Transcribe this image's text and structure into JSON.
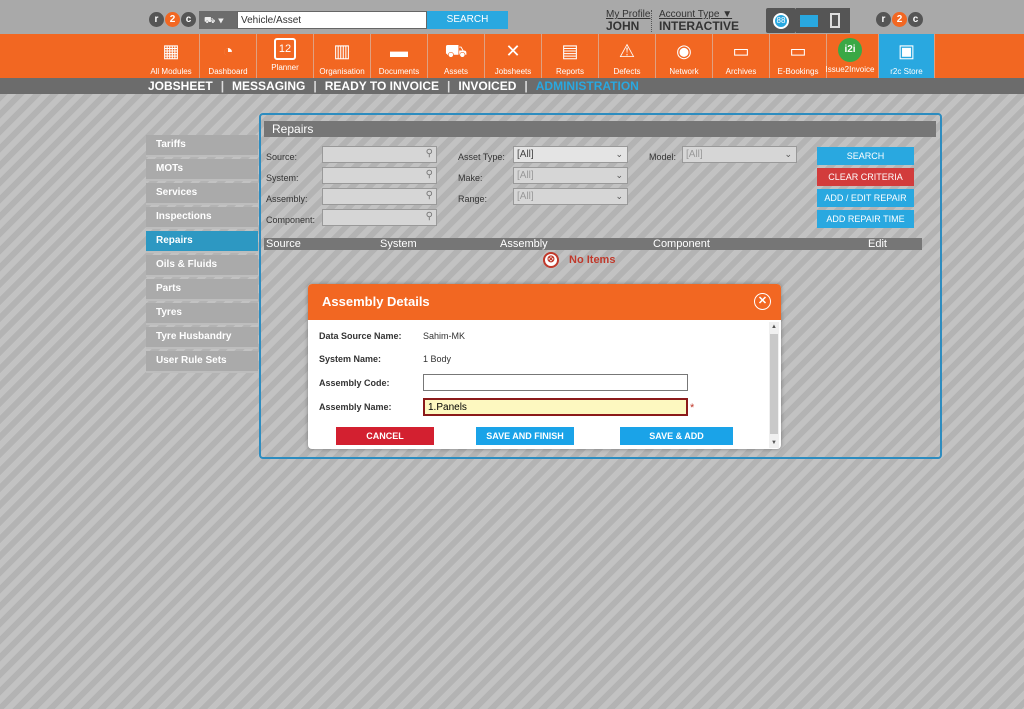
{
  "header": {
    "logo_left": [
      "r",
      "2",
      "c"
    ],
    "logo_right": [
      "r",
      "2",
      "c"
    ],
    "search_placeholder": "Vehicle/Asset",
    "search_button": "SEARCH",
    "my_profile": "My Profile",
    "user_name": "JOHN",
    "account_type": "Account Type",
    "account_name": "INTERACTIVE",
    "notif_count": "88"
  },
  "nav": {
    "modules": [
      {
        "label": "All Modules",
        "icon": "grid-icon",
        "glyph": "▦"
      },
      {
        "label": "Dashboard",
        "icon": "speedometer-icon",
        "glyph": "◔"
      },
      {
        "label": "Planner",
        "icon": "calendar-icon",
        "glyph": "12"
      },
      {
        "label": "Organisation",
        "icon": "buildings-icon",
        "glyph": "▥"
      },
      {
        "label": "Documents",
        "icon": "folder-icon",
        "glyph": "▬"
      },
      {
        "label": "Assets",
        "icon": "truck-icon",
        "glyph": "⛟"
      },
      {
        "label": "Jobsheets",
        "icon": "tools-icon",
        "glyph": "✕"
      },
      {
        "label": "Reports",
        "icon": "clipboard-icon",
        "glyph": "▤"
      },
      {
        "label": "Defects",
        "icon": "warning-icon",
        "glyph": "⚠"
      },
      {
        "label": "Network",
        "icon": "contacts-icon",
        "glyph": "◉"
      },
      {
        "label": "Archives",
        "icon": "archive-icon",
        "glyph": "▭"
      },
      {
        "label": "E-Bookings",
        "icon": "laptop-icon",
        "glyph": "▭"
      },
      {
        "label": "Issue2Invoice",
        "icon": "i2i-icon",
        "glyph": "i2i"
      },
      {
        "label": "r2c Store",
        "icon": "briefcase-icon",
        "glyph": "▣"
      }
    ]
  },
  "subnav": {
    "items": [
      "JOBSHEET",
      "MESSAGING",
      "READY TO INVOICE",
      "INVOICED",
      "ADMINISTRATION"
    ],
    "sep": "|"
  },
  "sidebar": {
    "items": [
      "Tariffs",
      "MOTs",
      "Services",
      "Inspections",
      "Repairs",
      "Oils & Fluids",
      "Parts",
      "Tyres",
      "Tyre Husbandry",
      "User Rule Sets"
    ]
  },
  "repairs": {
    "title": "Repairs",
    "labels": {
      "source": "Source:",
      "system": "System:",
      "assembly": "Assembly:",
      "component": "Component:",
      "asset_type": "Asset Type:",
      "make": "Make:",
      "range": "Range:",
      "model": "Model:"
    },
    "selects": {
      "asset_type": "[All]",
      "make": "[All]",
      "range": "[All]",
      "model": "[All]"
    },
    "buttons": {
      "search": "SEARCH",
      "clear": "CLEAR CRITERIA",
      "add_edit": "ADD / EDIT REPAIR",
      "add_time": "ADD REPAIR TIME"
    },
    "table_headers": [
      "Source",
      "System",
      "Assembly",
      "Component",
      "Edit"
    ],
    "no_items": "No Items",
    "no_items_icon": "⊗"
  },
  "modal": {
    "title": "Assembly Details",
    "close": "✕",
    "fields": {
      "data_source_label": "Data Source Name:",
      "data_source_value": "Sahim-MK",
      "system_label": "System Name:",
      "system_value": "1 Body",
      "code_label": "Assembly Code:",
      "code_value": "",
      "name_label": "Assembly Name:",
      "name_value": "1.Panels",
      "required_mark": "*"
    },
    "buttons": {
      "cancel": "CANCEL",
      "save_finish": "SAVE AND FINISH",
      "save_add": "SAVE & ADD COMPONENT"
    },
    "colors": {
      "cancel": "#d32030",
      "primary": "#1aa3e8",
      "header": "#f26722"
    }
  }
}
